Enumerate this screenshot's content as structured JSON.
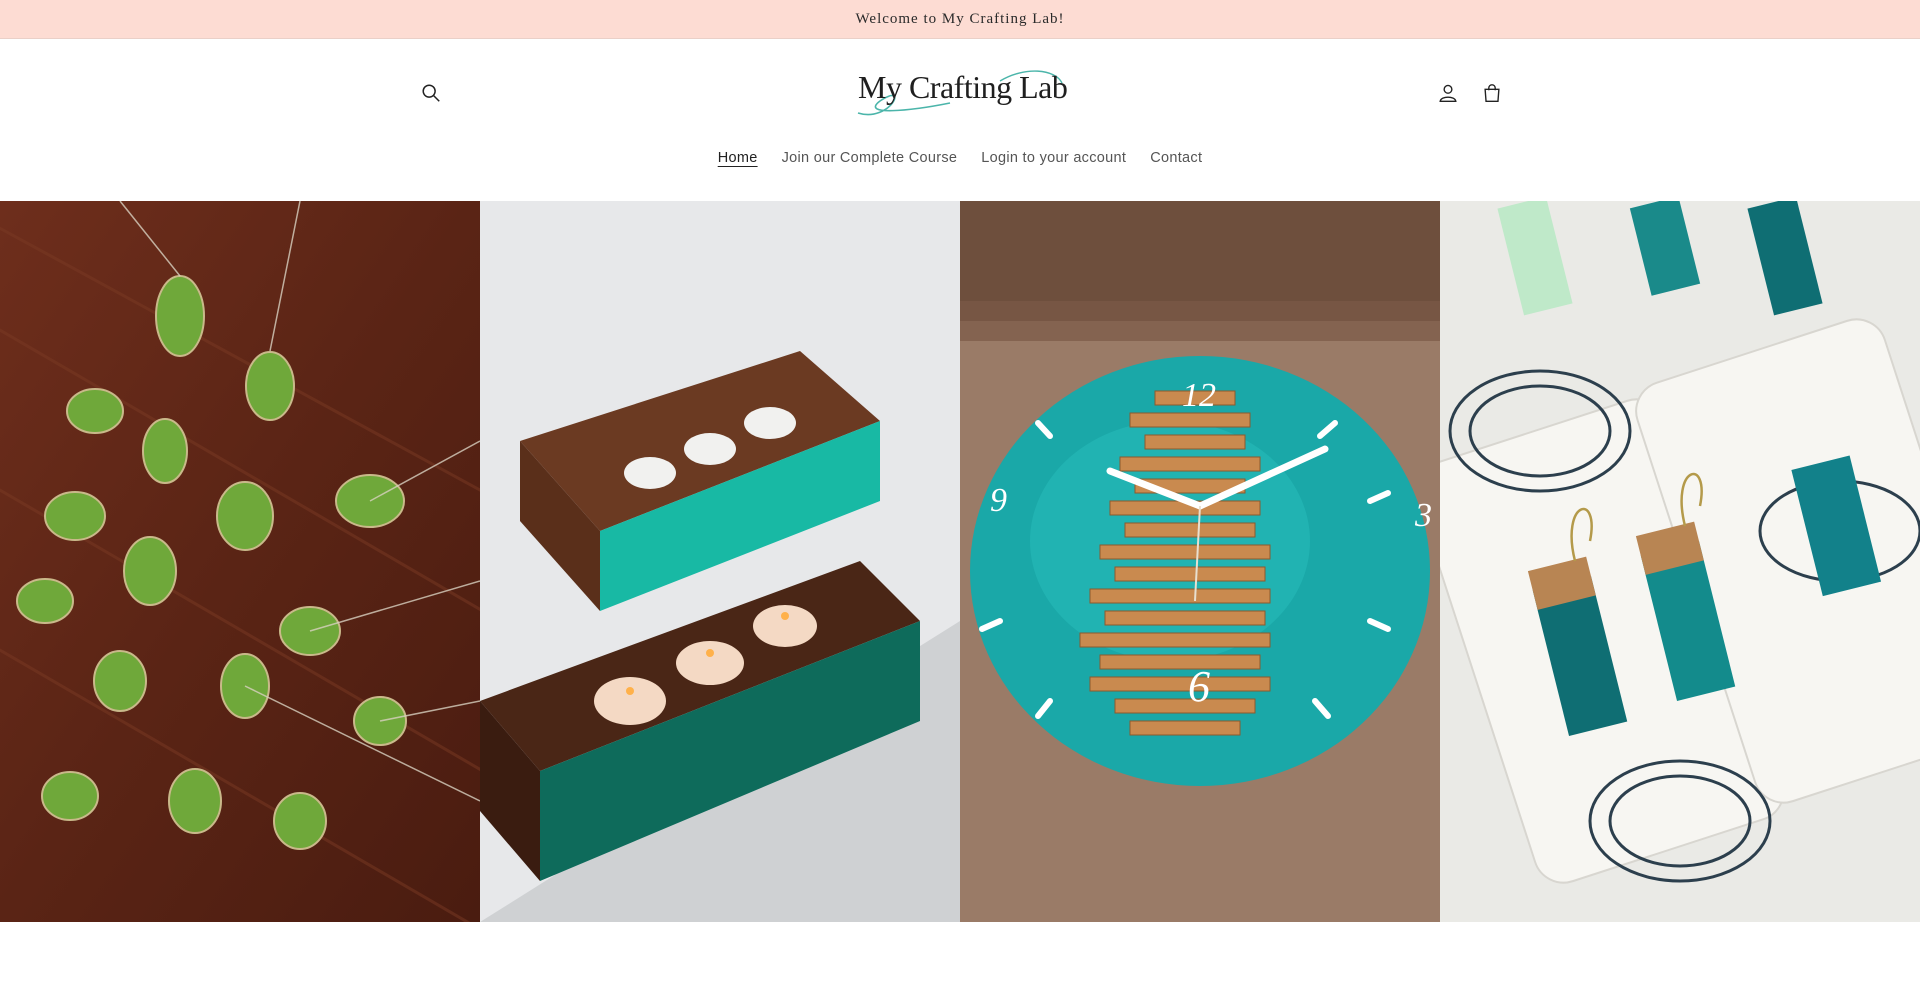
{
  "announcement": {
    "text": "Welcome to My Crafting Lab!"
  },
  "header": {
    "logo_text": "My Crafting Lab",
    "icons": {
      "search": "search-icon",
      "account": "user-icon",
      "cart": "bag-icon"
    }
  },
  "nav": {
    "items": [
      {
        "label": "Home",
        "active": true
      },
      {
        "label": "Join our Complete Course",
        "active": false
      },
      {
        "label": "Login to your account",
        "active": false
      },
      {
        "label": "Contact",
        "active": false
      }
    ]
  },
  "hero": {
    "panels": [
      {
        "subject": "fern leaf resin pendant necklaces on wood"
      },
      {
        "subject": "wood and teal resin tealight candle holders"
      },
      {
        "subject": "teal resin wall clock with wood strips",
        "clock_numerals": {
          "twelve": "12",
          "three": "3",
          "six": "6",
          "nine": "9"
        }
      },
      {
        "subject": "wood and teal resin drop earrings on cards"
      }
    ]
  },
  "colors": {
    "announcement_bg": "#fddcd3",
    "resin_teal": "#1aa8a8",
    "logo_swash": "#4bb5aa"
  }
}
